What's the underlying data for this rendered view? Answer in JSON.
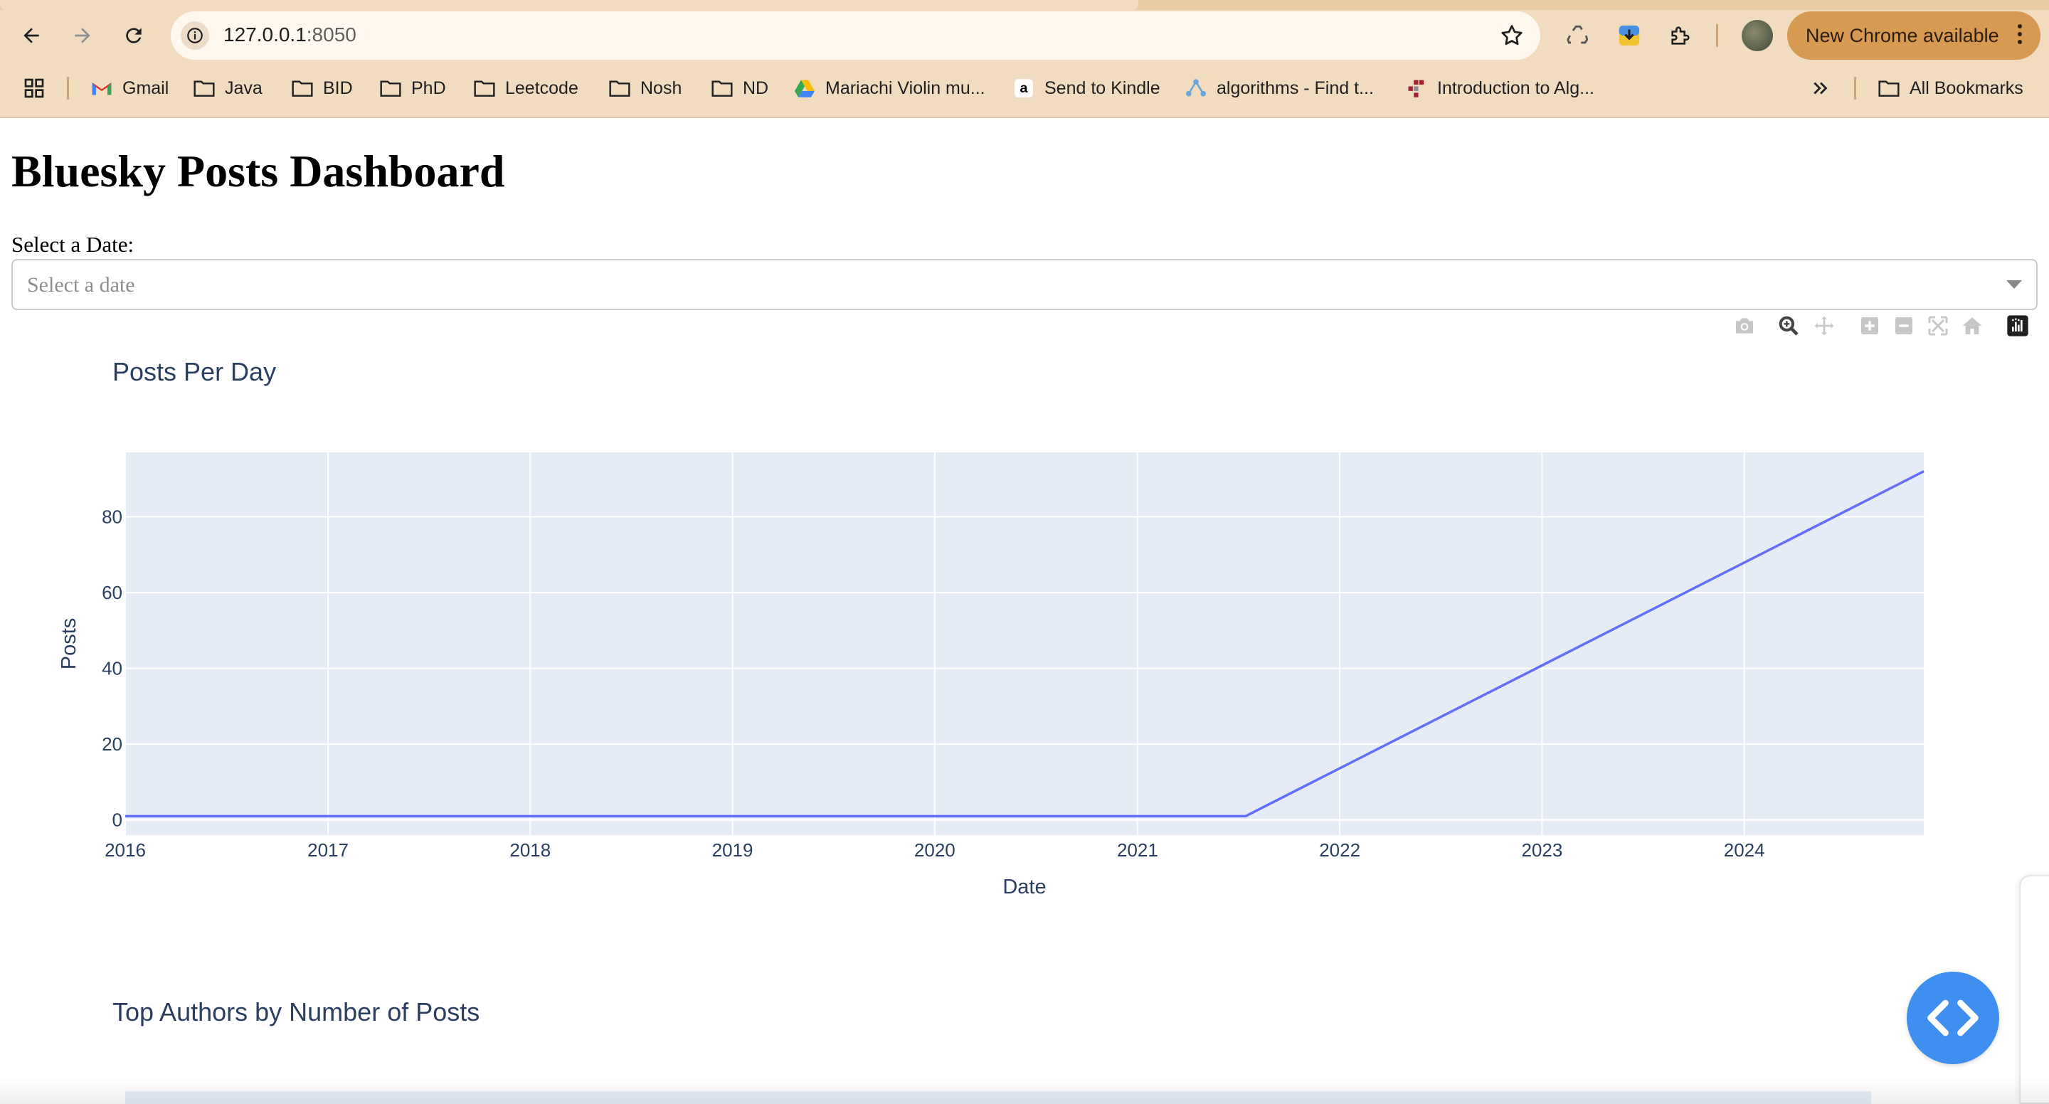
{
  "browser": {
    "url_host": "127.0.0.1",
    "url_port": ":8050",
    "update_label": "New Chrome available",
    "bookmarks": [
      {
        "label": "Gmail",
        "icon": "gmail-icon"
      },
      {
        "label": "Java",
        "icon": "folder-icon"
      },
      {
        "label": "BID",
        "icon": "folder-icon"
      },
      {
        "label": "PhD",
        "icon": "folder-icon"
      },
      {
        "label": "Leetcode",
        "icon": "folder-icon"
      },
      {
        "label": "Nosh",
        "icon": "folder-icon"
      },
      {
        "label": "ND",
        "icon": "folder-icon"
      },
      {
        "label": "Mariachi Violin mu...",
        "icon": "google-drive-icon"
      },
      {
        "label": "Send to Kindle",
        "icon": "amazon-icon"
      },
      {
        "label": "algorithms - Find t...",
        "icon": "stackexchange-icon"
      },
      {
        "label": "Introduction to Alg...",
        "icon": "course-icon"
      }
    ],
    "all_bookmarks_label": "All Bookmarks"
  },
  "page": {
    "title": "Bluesky Posts Dashboard",
    "date_label": "Select a Date:",
    "date_placeholder": "Select a date"
  },
  "chart_data": [
    {
      "type": "line",
      "title": "Posts Per Day",
      "xlabel": "Date",
      "ylabel": "Posts",
      "x": [
        "2016-01-01",
        "2021-07-15",
        "2024-11-20"
      ],
      "y": [
        1,
        1,
        92
      ],
      "xlim": [
        "2016-01-01",
        "2024-11-20"
      ],
      "ylim": [
        -4,
        97
      ],
      "x_ticks": [
        "2016",
        "2017",
        "2018",
        "2019",
        "2020",
        "2021",
        "2022",
        "2023",
        "2024"
      ],
      "y_ticks": [
        0,
        20,
        40,
        60,
        80
      ],
      "grid": true,
      "line_color": "#636efa",
      "plot_bg": "#e5ecf6"
    },
    {
      "type": "bar",
      "title": "Top Authors by Number of Posts"
    }
  ]
}
